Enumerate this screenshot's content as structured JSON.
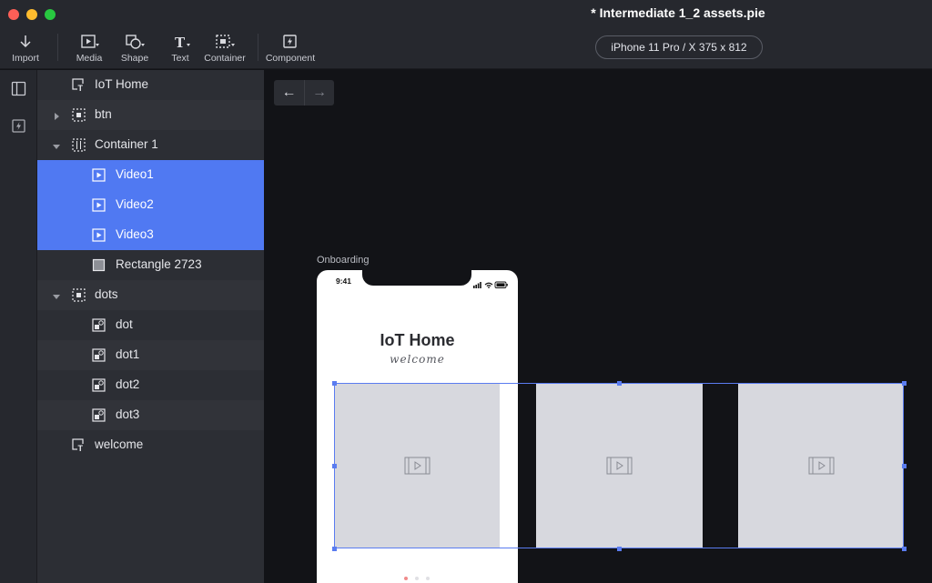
{
  "window": {
    "title": "* Intermediate 1_2 assets.pie"
  },
  "toolbar": {
    "items": [
      {
        "label": "Import",
        "icon": "import-icon"
      },
      {
        "label": "Media",
        "icon": "media-icon"
      },
      {
        "label": "Shape",
        "icon": "shape-icon"
      },
      {
        "label": "Text",
        "icon": "text-icon"
      },
      {
        "label": "Container",
        "icon": "container-icon"
      },
      {
        "label": "Component",
        "icon": "component-icon"
      }
    ],
    "text_glyph": "T",
    "device": "iPhone 11 Pro / X  375 x 812"
  },
  "rail": {
    "items": [
      {
        "icon": "panel-icon"
      },
      {
        "icon": "lightning-icon"
      }
    ]
  },
  "layers": {
    "items": [
      {
        "label": "IoT Home",
        "icon": "text-layer-icon",
        "indent": 0,
        "expander": "none",
        "selected": false
      },
      {
        "label": "btn",
        "icon": "container-layer-icon",
        "indent": 0,
        "expander": "collapsed",
        "selected": false
      },
      {
        "label": "Container 1",
        "icon": "horizontal-container-icon",
        "indent": 0,
        "expander": "expanded",
        "selected": false
      },
      {
        "label": "Video1",
        "icon": "video-layer-icon",
        "indent": 1,
        "expander": "none",
        "selected": true
      },
      {
        "label": "Video2",
        "icon": "video-layer-icon",
        "indent": 1,
        "expander": "none",
        "selected": true
      },
      {
        "label": "Video3",
        "icon": "video-layer-icon",
        "indent": 1,
        "expander": "none",
        "selected": true
      },
      {
        "label": "Rectangle 2723",
        "icon": "rectangle-layer-icon",
        "indent": 1,
        "expander": "none",
        "selected": false
      },
      {
        "label": "dots",
        "icon": "container-layer-icon",
        "indent": 0,
        "expander": "expanded",
        "selected": false
      },
      {
        "label": "dot",
        "icon": "image-layer-icon",
        "indent": 1,
        "expander": "none",
        "selected": false
      },
      {
        "label": "dot1",
        "icon": "image-layer-icon",
        "indent": 1,
        "expander": "none",
        "selected": false
      },
      {
        "label": "dot2",
        "icon": "image-layer-icon",
        "indent": 1,
        "expander": "none",
        "selected": false
      },
      {
        "label": "dot3",
        "icon": "image-layer-icon",
        "indent": 1,
        "expander": "none",
        "selected": false
      },
      {
        "label": "welcome",
        "icon": "text-layer-icon",
        "indent": 0,
        "expander": "none",
        "selected": false
      }
    ],
    "selection_color": "#5079f2"
  },
  "canvas": {
    "back_icon": "arrow-left-icon",
    "forward_icon": "arrow-right-icon",
    "back_glyph": "←",
    "forward_glyph": "→",
    "frame_label": "Onboarding",
    "phone": {
      "time": "9:41",
      "title": "IoT Home",
      "subtitle": "welcome",
      "active_dot_color": "#f08b8b"
    },
    "videos": [
      {
        "name": "Video1"
      },
      {
        "name": "Video2"
      },
      {
        "name": "Video3"
      }
    ],
    "selection_color": "#5a7cf0"
  }
}
